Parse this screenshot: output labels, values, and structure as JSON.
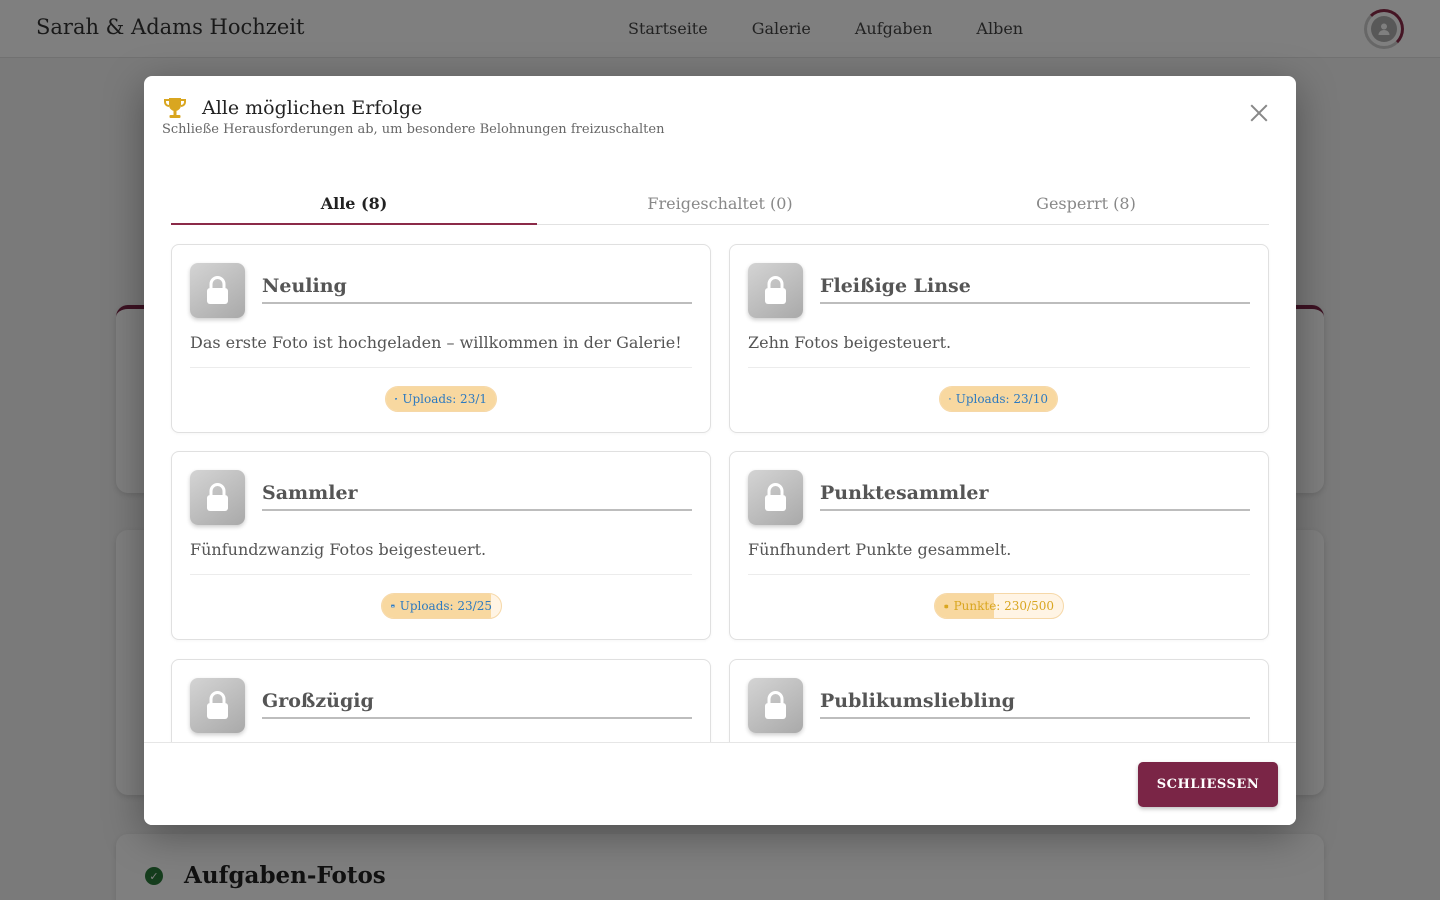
{
  "header": {
    "brand": "Sarah & Adams Hochzeit",
    "nav": [
      "Startseite",
      "Galerie",
      "Aufgaben",
      "Alben"
    ]
  },
  "background": {
    "section_title": "Aufgaben-Fotos"
  },
  "modal": {
    "title": "Alle möglichen Erfolge",
    "subtitle": "Schließe Herausforderungen ab, um besondere Belohnungen freizuschalten",
    "tabs": [
      {
        "label": "Alle (8)",
        "active": true
      },
      {
        "label": "Freigeschaltet (0)",
        "active": false
      },
      {
        "label": "Gesperrt (8)",
        "active": false
      }
    ],
    "achievements": [
      {
        "title": "Neuling",
        "description": "Das erste Foto ist hochgeladen – willkommen in der Galerie!",
        "progress_label": "Uploads: 23/1",
        "progress_icon": "image-icon",
        "progress_fraction": 1.0
      },
      {
        "title": "Fleißige Linse",
        "description": "Zehn Fotos beigesteuert.",
        "progress_label": "Uploads: 23/10",
        "progress_icon": "image-icon",
        "progress_fraction": 1.0
      },
      {
        "title": "Sammler",
        "description": "Fünfundzwanzig Fotos beigesteuert.",
        "progress_label": "Uploads: 23/25",
        "progress_icon": "image-icon",
        "progress_fraction": 0.92
      },
      {
        "title": "Punktesammler",
        "description": "Fünfhundert Punkte gesammelt.",
        "progress_label": "Punkte: 230/500",
        "progress_icon": "coin-icon",
        "progress_fraction": 0.46
      },
      {
        "title": "Großzügig",
        "description": "",
        "progress_label": "",
        "progress_icon": "",
        "progress_fraction": 0
      },
      {
        "title": "Publikumsliebling",
        "description": "",
        "progress_label": "",
        "progress_icon": "",
        "progress_fraction": 0
      }
    ],
    "close_button": "SCHLIESSEN"
  },
  "colors": {
    "accent": "#7a2546",
    "progress_fill": "#f8d8a0",
    "progress_text_uploads": "#2d7ac0",
    "progress_text_points": "#d9a620"
  }
}
